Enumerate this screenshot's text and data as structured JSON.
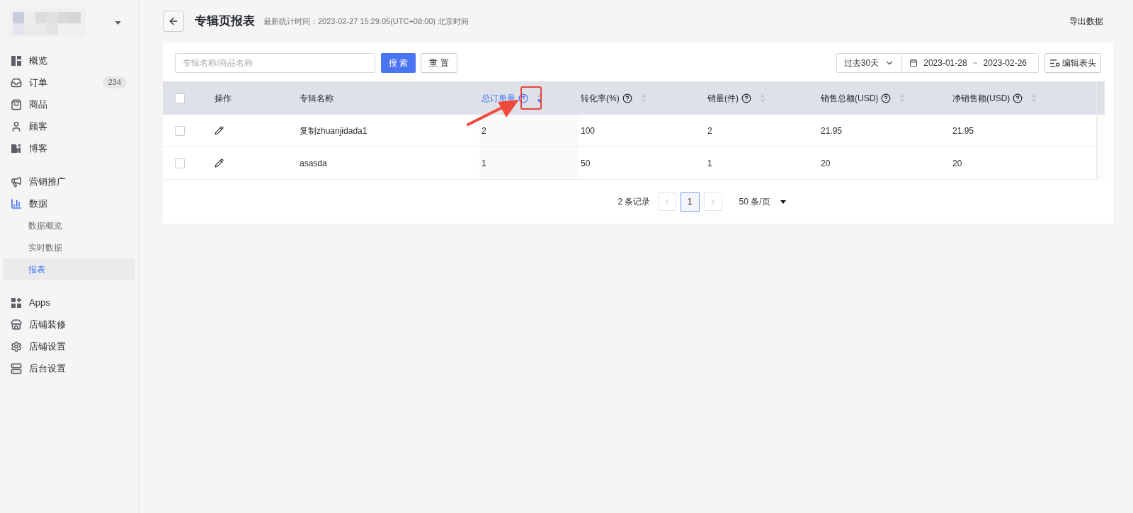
{
  "sidebar": {
    "groups": [
      {
        "items": [
          {
            "label": "概览",
            "active": false
          },
          {
            "label": "订单",
            "active": false,
            "badge": "234"
          },
          {
            "label": "商品",
            "active": false
          },
          {
            "label": "顾客",
            "active": false
          },
          {
            "label": "博客",
            "active": false
          }
        ]
      },
      {
        "items": [
          {
            "label": "营销推广",
            "active": false
          },
          {
            "label": "数据",
            "active": true,
            "children": [
              {
                "label": "数据概览",
                "selected": false
              },
              {
                "label": "实时数据",
                "selected": false
              },
              {
                "label": "报表",
                "selected": true
              }
            ]
          }
        ]
      },
      {
        "items": [
          {
            "label": "Apps",
            "active": false
          },
          {
            "label": "店铺装修",
            "active": false
          },
          {
            "label": "店铺设置",
            "active": false
          },
          {
            "label": "后台设置",
            "active": false
          }
        ]
      }
    ]
  },
  "header": {
    "title": "专辑页报表",
    "subtitle": "最新统计时间：2023-02-27 15:29:05(UTC+08:00) 北京时间",
    "export": "导出数据"
  },
  "toolbar": {
    "search": {
      "placeholder": "专辑名称/商品名称"
    },
    "search_button": "搜 索",
    "reset_button": "重 置",
    "range": "过去30天",
    "date_start": "2023-01-28",
    "date_sep": "~",
    "date_end": "2023-02-26",
    "edit_columns": "编辑表头"
  },
  "table": {
    "select_all": {
      "checked": false
    },
    "action_column": {
      "label": "操作"
    },
    "columns": [
      {
        "label": "专辑名称",
        "kind": "plain",
        "sorted": false,
        "annotated": false
      },
      {
        "label": "总订单量",
        "kind": "metric",
        "sorted": true,
        "annotated": true
      },
      {
        "label": "转化率(%)",
        "kind": "metric",
        "sorted": false,
        "annotated": false
      },
      {
        "label": "销量(件)",
        "kind": "metric",
        "sorted": false,
        "annotated": false
      },
      {
        "label": "销售总额(USD)",
        "kind": "metric",
        "sorted": false,
        "annotated": false
      },
      {
        "label": "净销售额(USD)",
        "kind": "metric",
        "sorted": false,
        "annotated": false
      }
    ],
    "rows": [
      {
        "checked": false,
        "cells": [
          "复制zhuanjidada1",
          "2",
          "100",
          "2",
          "21.95",
          "21.95"
        ]
      },
      {
        "checked": false,
        "cells": [
          "asasda",
          "1",
          "50",
          "1",
          "20",
          "20"
        ]
      }
    ]
  },
  "pagination": {
    "total": "2 条记录",
    "pages": [
      {
        "label": "1",
        "selected": true
      }
    ],
    "page_size": "50 条/页"
  }
}
